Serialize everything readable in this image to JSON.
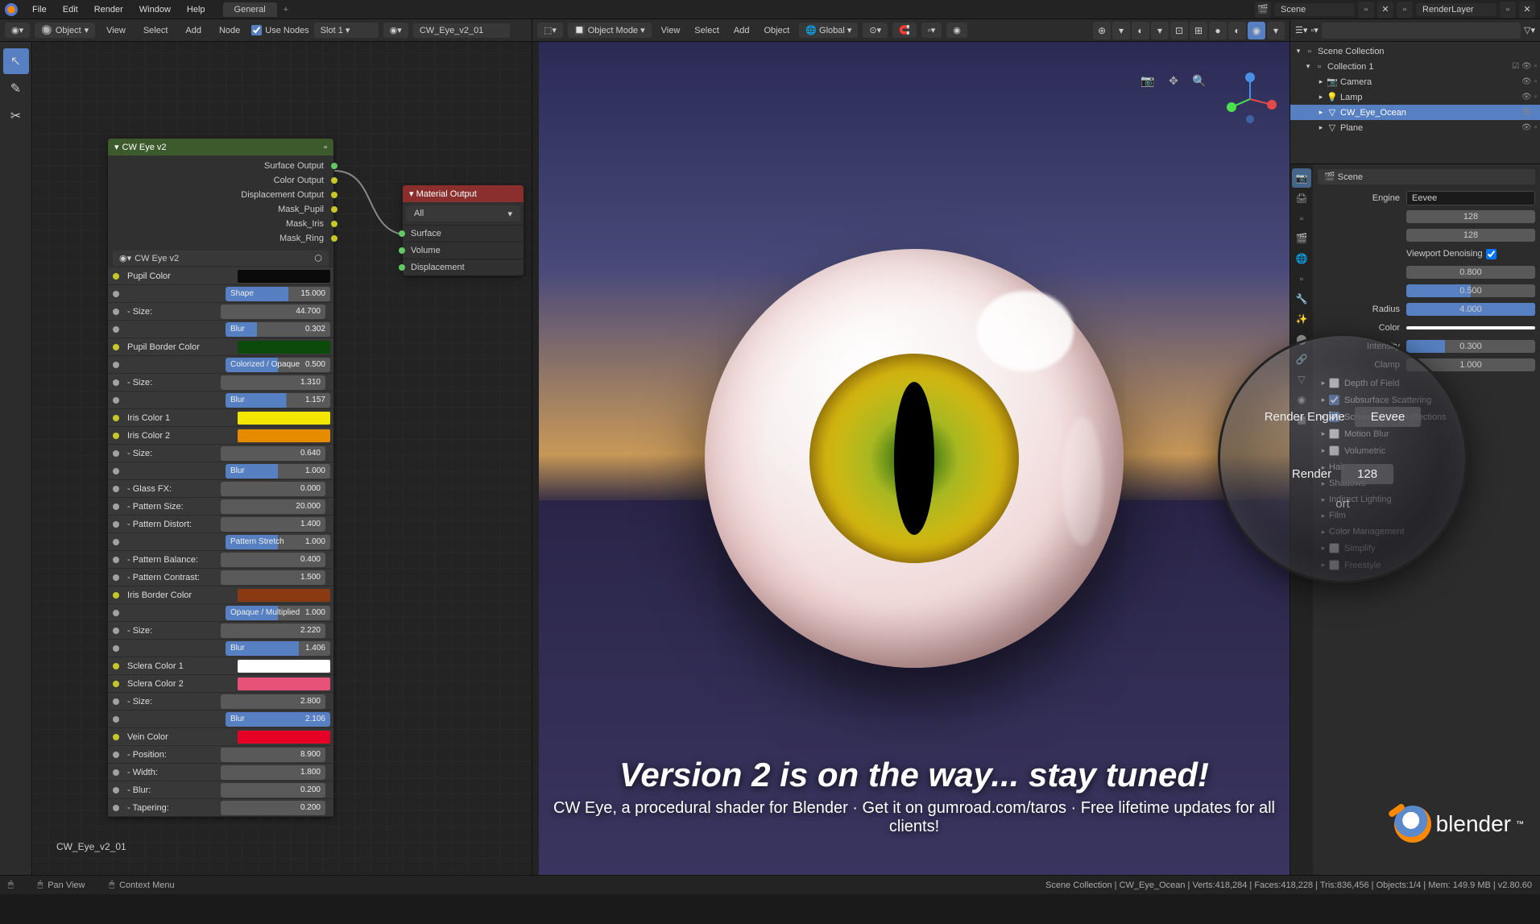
{
  "menubar": {
    "items": [
      "File",
      "Edit",
      "Render",
      "Window",
      "Help"
    ],
    "workspace": "General",
    "scene_label": "Scene",
    "layer_label": "RenderLayer"
  },
  "node_toolbar": {
    "mode": "Object",
    "menus": [
      "View",
      "Select",
      "Add",
      "Node"
    ],
    "use_nodes": "Use Nodes",
    "slot": "Slot 1",
    "material": "CW_Eye_v2_01"
  },
  "vp_header": {
    "mode": "Object Mode",
    "menus": [
      "View",
      "Select",
      "Add",
      "Object"
    ],
    "orient": "Global"
  },
  "nodes": {
    "group_title": "CW Eye v2",
    "outputs": [
      "Surface Output",
      "Color Output",
      "Displacement Output",
      "Mask_Pupil",
      "Mask_Iris",
      "Mask_Ring"
    ],
    "sub_label": "CW Eye v2",
    "mat_title": "Material Output",
    "mat_dd": "All",
    "mat_inputs": [
      "Surface",
      "Volume",
      "Displacement"
    ]
  },
  "props": [
    {
      "type": "color",
      "label": "Pupil Color",
      "color": "#0a0a0a"
    },
    {
      "type": "slider",
      "label": "- Shape:",
      "value": "15.000",
      "p": 60
    },
    {
      "type": "num",
      "label": "- Size:",
      "value": "44.700"
    },
    {
      "type": "slider",
      "label": "- Blur:",
      "value": "0.302",
      "p": 30
    },
    {
      "type": "color",
      "label": "Pupil Border Color",
      "color": "#0b4a0b"
    },
    {
      "type": "slider",
      "label": "- Colorized / Opaque:",
      "value": "0.500",
      "p": 50
    },
    {
      "type": "num",
      "label": "- Size:",
      "value": "1.310"
    },
    {
      "type": "slider",
      "label": "- Blur:",
      "value": "1.157",
      "p": 58
    },
    {
      "type": "color",
      "label": "Iris Color 1",
      "color": "#f5e600"
    },
    {
      "type": "color",
      "label": "Iris Color 2",
      "color": "#e68a00"
    },
    {
      "type": "num",
      "label": "- Size:",
      "value": "0.640"
    },
    {
      "type": "slider",
      "label": "- Blur:",
      "value": "1.000",
      "p": 50
    },
    {
      "type": "num",
      "label": "- Glass FX:",
      "value": "0.000"
    },
    {
      "type": "num",
      "label": "- Pattern Size:",
      "value": "20.000"
    },
    {
      "type": "num",
      "label": "- Pattern Distort:",
      "value": "1.400"
    },
    {
      "type": "slider",
      "label": "- Pattern Stretch:",
      "value": "1.000",
      "p": 50
    },
    {
      "type": "num",
      "label": "- Pattern Balance:",
      "value": "0.400"
    },
    {
      "type": "num",
      "label": "- Pattern Contrast:",
      "value": "1.500"
    },
    {
      "type": "color",
      "label": "Iris Border Color",
      "color": "#8a3a12"
    },
    {
      "type": "slider",
      "label": "- Opaque / Multiplied:",
      "value": "1.000",
      "p": 50
    },
    {
      "type": "num",
      "label": "- Size:",
      "value": "2.220"
    },
    {
      "type": "slider",
      "label": "- Blur:",
      "value": "1.406",
      "p": 70
    },
    {
      "type": "color",
      "label": "Sclera Color 1",
      "color": "#ffffff"
    },
    {
      "type": "color",
      "label": "Sclera Color 2",
      "color": "#e6527a"
    },
    {
      "type": "num",
      "label": "- Size:",
      "value": "2.800"
    },
    {
      "type": "slider",
      "label": "- Blur:",
      "value": "2.106",
      "p": 100
    },
    {
      "type": "color",
      "label": "Vein Color",
      "color": "#e60026"
    },
    {
      "type": "num",
      "label": "- Position:",
      "value": "8.900"
    },
    {
      "type": "num",
      "label": "- Width:",
      "value": "1.800"
    },
    {
      "type": "num",
      "label": "- Blur:",
      "value": "0.200"
    },
    {
      "type": "num",
      "label": "- Tapering:",
      "value": "0.200"
    }
  ],
  "node_footer": "CW_Eye_v2_01",
  "outliner": {
    "root": "Scene Collection",
    "collection": "Collection 1",
    "items": [
      {
        "name": "Camera",
        "icon": "📷"
      },
      {
        "name": "Lamp",
        "icon": "💡"
      },
      {
        "name": "CW_Eye_Ocean",
        "icon": "▽",
        "selected": true
      },
      {
        "name": "Plane",
        "icon": "▽"
      }
    ]
  },
  "right_props": {
    "breadcrumb": "Scene",
    "engine_label": "Engine",
    "engine_value": "Eevee",
    "samples": [
      {
        "label": "",
        "value": "128"
      },
      {
        "label": "",
        "value": "128"
      }
    ],
    "denoise": "Viewport Denoising",
    "settings": [
      {
        "label": "",
        "value": "0.800",
        "p": 80
      },
      {
        "label": "",
        "value": "0.500",
        "p": 50,
        "slider": true
      },
      {
        "label": "Radius",
        "value": "4.000",
        "p": 100,
        "slider": true
      },
      {
        "label": "Color",
        "value": "",
        "color": "#ffffff"
      },
      {
        "label": "Intensity",
        "value": "0.300",
        "p": 30,
        "slider": true
      },
      {
        "label": "Clamp",
        "value": "1.000"
      }
    ],
    "sections": [
      {
        "label": "Depth of Field",
        "checked": false
      },
      {
        "label": "Subsurface Scattering",
        "checked": true
      },
      {
        "label": "Screen Space Reflections",
        "checked": true
      },
      {
        "label": "Motion Blur",
        "checked": false
      },
      {
        "label": "Volumetric",
        "checked": false
      },
      {
        "label": "Hair",
        "nocheck": true
      },
      {
        "label": "Shadows",
        "nocheck": true
      },
      {
        "label": "Indirect Lighting",
        "nocheck": true
      },
      {
        "label": "Film",
        "nocheck": true
      },
      {
        "label": "Color Management",
        "nocheck": true
      },
      {
        "label": "Simplify",
        "checked": false
      },
      {
        "label": "Freestyle",
        "checked": false
      }
    ]
  },
  "magnifier": {
    "engine_label": "Render Engine",
    "engine_value": "Eevee",
    "render_label": "Render",
    "render_value": "128",
    "port_label": "ort"
  },
  "promo": {
    "title": "Version 2 is on the way... stay tuned!",
    "sub": "CW Eye, a procedural shader for Blender · Get it on gumroad.com/taros · Free lifetime updates for all clients!"
  },
  "logo_text": "blender",
  "statusbar": {
    "pan": "Pan View",
    "context": "Context Menu",
    "stats": "Scene Collection | CW_Eye_Ocean | Verts:418,284 | Faces:418,228 | Tris:836,456 | Objects:1/4 | Mem: 149.9 MB | v2.80.60"
  }
}
